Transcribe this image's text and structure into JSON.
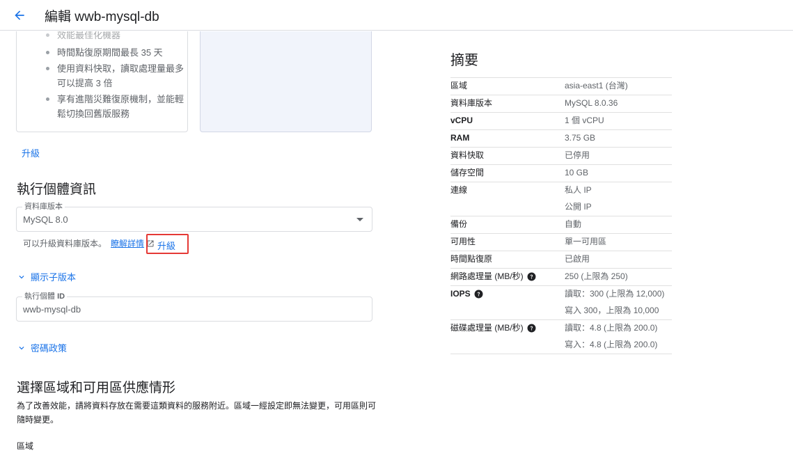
{
  "header": {
    "title": "編輯 wwb-mysql-db"
  },
  "edition_card": {
    "features": [
      "效能最佳化機器",
      "時間點復原期間最長 35 天",
      "使用資料快取，讀取處理量最多可以提高 3 倍",
      "享有進階災難復原機制，並能輕鬆切換回舊版服務"
    ]
  },
  "upgrade_link_top": "升級",
  "instance_section": {
    "title": "執行個體資訊",
    "db_version": {
      "label": "資料庫版本",
      "value": "MySQL 8.0"
    },
    "hint_text": "可以升級資料庫版本。",
    "learn_more": "瞭解詳情",
    "upgrade_label": "升級",
    "show_minor": "顯示子版本",
    "instance_id": {
      "label_prefix": "執行個體",
      "label_bold": "ID",
      "value": "wwb-mysql-db"
    },
    "password_policy": "密碼政策"
  },
  "region_section": {
    "title": "選擇區域和可用區供應情形",
    "description": "為了改善效能，請將資料存放在需要這類資料的服務附近。區域一經設定即無法變更，可用區則可隨時變更。",
    "region_label": "區域"
  },
  "summary": {
    "title": "摘要",
    "rows": [
      {
        "key": "區域",
        "values": [
          "asia-east1 (台灣)"
        ]
      },
      {
        "key": "資料庫版本",
        "values": [
          "MySQL 8.0.36"
        ]
      },
      {
        "key": "vCPU",
        "values": [
          "1 個 vCPU"
        ],
        "bold": true
      },
      {
        "key": "RAM",
        "values": [
          "3.75 GB"
        ],
        "bold": true
      },
      {
        "key": "資料快取",
        "values": [
          "已停用"
        ]
      },
      {
        "key": "儲存空間",
        "values": [
          "10 GB"
        ]
      },
      {
        "key": "連線",
        "values": [
          "私人 IP",
          "公開 IP"
        ]
      },
      {
        "key": "備份",
        "values": [
          "自動"
        ]
      },
      {
        "key": "可用性",
        "values": [
          "單一可用區"
        ]
      },
      {
        "key": "時間點復原",
        "values": [
          "已啟用"
        ]
      },
      {
        "key": "網路處理量 (MB/秒)",
        "values": [
          "250 (上限為 250)"
        ],
        "help": true
      },
      {
        "key": "IOPS",
        "values": [
          "讀取：300 (上限為 12,000)",
          "寫入 300，上限為 10,000"
        ],
        "help": true,
        "bold": true
      },
      {
        "key": "磁碟處理量 (MB/秒)",
        "values": [
          "讀取：4.8 (上限為 200.0)",
          "寫入：4.8 (上限為 200.0)"
        ],
        "help": true
      }
    ]
  }
}
